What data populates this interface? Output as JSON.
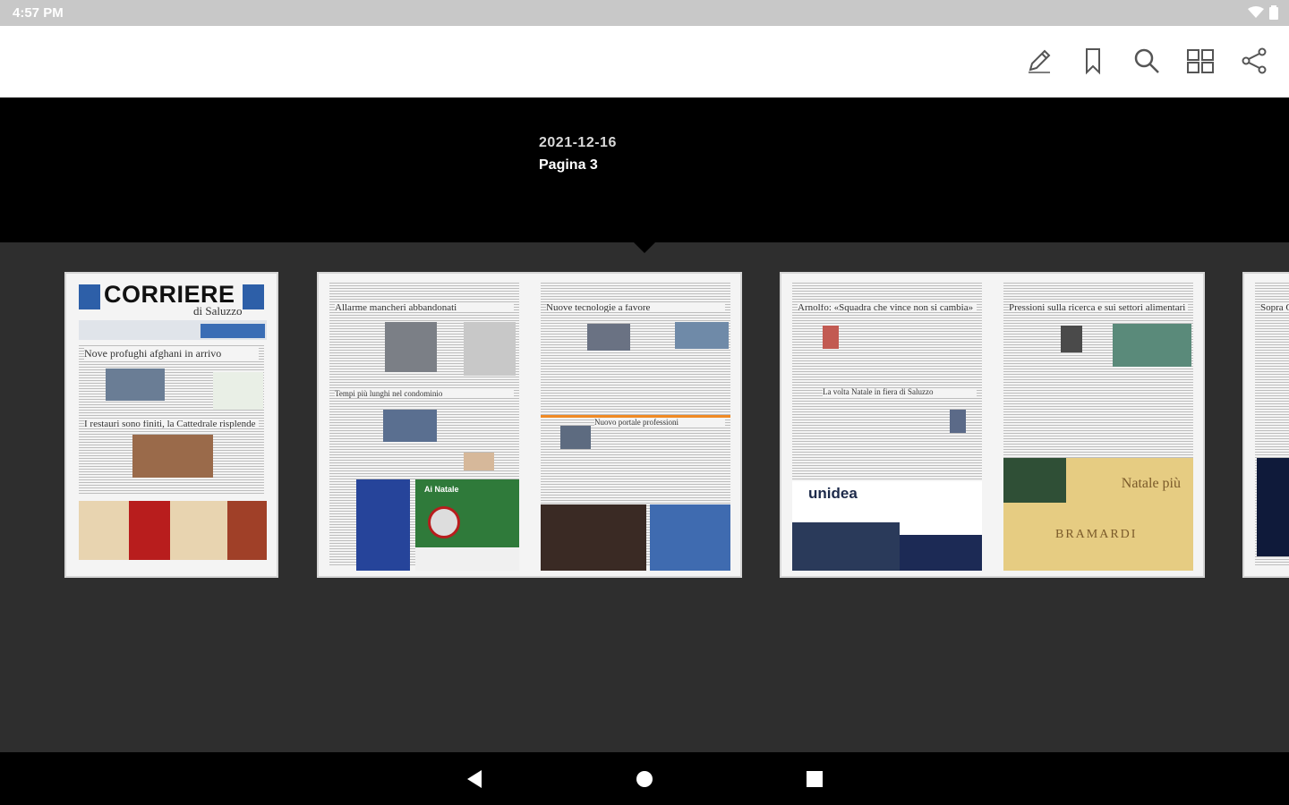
{
  "status_bar": {
    "time": "4:57 PM"
  },
  "toolbar": {
    "icons": [
      "edit-icon",
      "bookmark-icon",
      "search-icon",
      "grid-view-icon",
      "share-icon"
    ]
  },
  "issue": {
    "date": "2021-12-16",
    "page_label": "Pagina 3"
  },
  "thumbnails": {
    "cover": {
      "masthead": "CORRIERE",
      "subtitle": "di Saluzzo",
      "headline_1": "Nove profughi afghani in arrivo",
      "headline_2": "I restauri sono finiti, la Cattedrale risplende"
    },
    "spread_1": {
      "left_headline": "Allarme mancheri abbandonati",
      "left_sub": "Tempi più lunghi nel condominio",
      "right_headline": "Nuove tecnologie a favore",
      "right_sub": "Nuovo portale professioni",
      "ad_label": "Ai Natale"
    },
    "spread_2": {
      "left_headline": "Arnolfo: «Squadra che vince non si cambia»",
      "left_sub": "La volta Natale in fiera di Saluzzo",
      "right_headline": "Pressioni sulla ricerca e sui settori alimentari",
      "ad_brand": "unidea",
      "ad_brand_2": "BRAMARDI",
      "ad_tagline": "Natale più"
    },
    "partial": {
      "headline": "Sopra G"
    }
  },
  "colors": {
    "status_bar": "#c8c8c8",
    "toolbar": "#ffffff",
    "info_bar": "#000000",
    "strip": "#2e2e2e",
    "icon": "#555555"
  }
}
